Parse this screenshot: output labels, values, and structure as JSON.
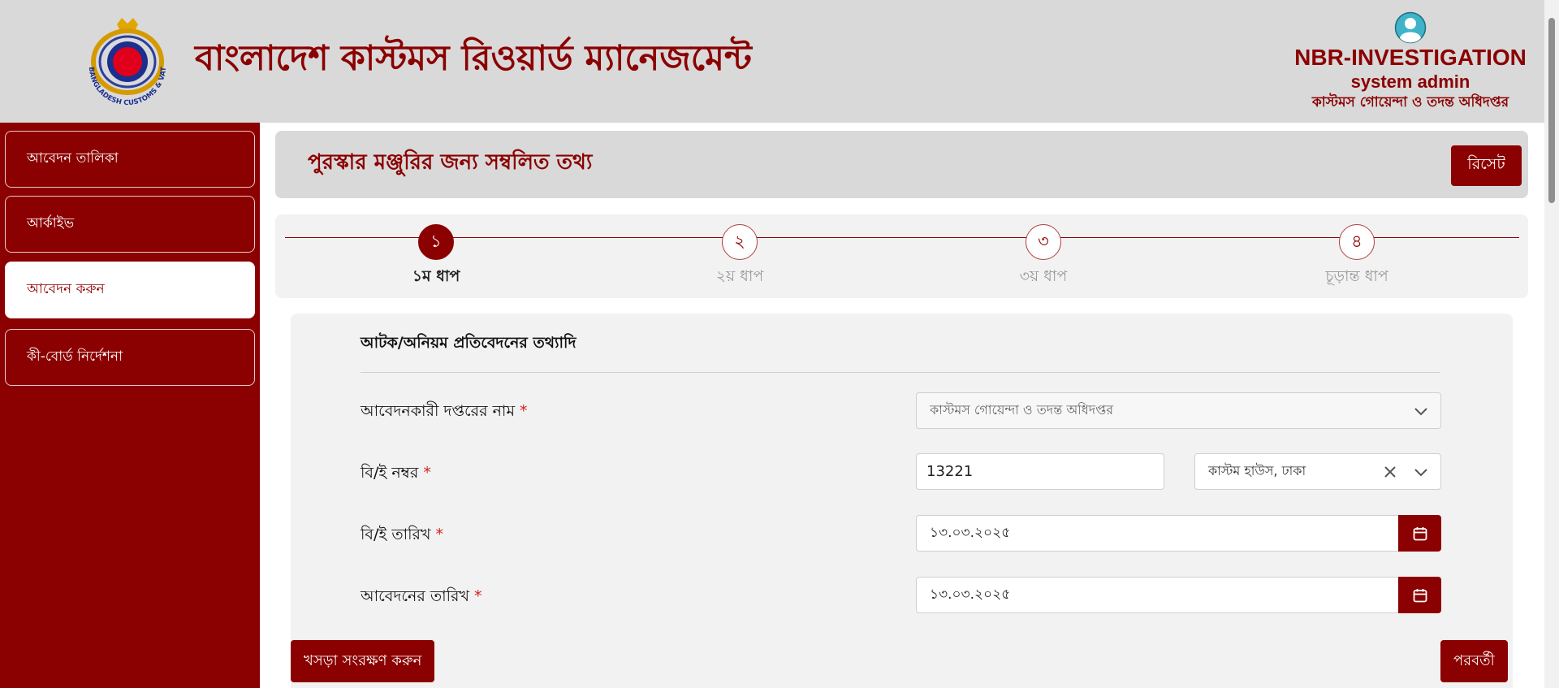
{
  "header": {
    "logo_text": "BANGLADESH CUSTOMS & VAT",
    "app_title": "বাংলাদেশ কাস্টমস রিওয়ার্ড ম্যানেজমেন্ট",
    "user": {
      "org": "NBR-INVESTIGATION",
      "name": "system admin",
      "office": "কাস্টমস গোয়েন্দা ও তদন্ত অধিদপ্তর"
    }
  },
  "sidebar": {
    "items": [
      {
        "label": "আবেদন তালিকা",
        "active": false
      },
      {
        "label": "আর্কাইভ",
        "active": false
      },
      {
        "label": "আবেদন করুন",
        "active": true
      },
      {
        "label": "কী-বোর্ড নির্দেশনা",
        "active": false
      }
    ]
  },
  "page": {
    "title": "পুরস্কার মঞ্জুরির জন্য সম্বলিত তথ্য",
    "reset_label": "রিসেট"
  },
  "stepper": {
    "steps": [
      {
        "number": "১",
        "label": "১ম ধাপ",
        "active": true
      },
      {
        "number": "২",
        "label": "২য় ধাপ",
        "active": false
      },
      {
        "number": "৩",
        "label": "৩য় ধাপ",
        "active": false
      },
      {
        "number": "৪",
        "label": "চূড়ান্ত ধাপ",
        "active": false
      }
    ]
  },
  "form": {
    "section_title": "আটক/অনিয়ম প্রতিবেদনের তথ্যাদি",
    "required_mark": "*",
    "fields": {
      "office_name": {
        "label": "আবেদনকারী দপ্তরের নাম",
        "value": "কাস্টমস গোয়েন্দা ও তদন্ত অধিদপ্তর"
      },
      "be_number": {
        "label": "বি/ই নম্বর",
        "value": "13221",
        "custom_house": "কাস্টম হাউস, ঢাকা"
      },
      "be_date": {
        "label": "বি/ই তারিখ",
        "value": "১৩.০৩.২০২৫"
      },
      "application_date": {
        "label": "আবেদনের তারিখ",
        "value": "১৩.০৩.২০২৫"
      }
    }
  },
  "footer": {
    "save_draft_label": "খসড়া সংরক্ষণ করুন",
    "next_label": "পরবর্তী"
  },
  "colors": {
    "primary": "#8b0000",
    "header_bg": "#d9d9d9",
    "card_bg": "#f2f2f2",
    "required": "#d42020"
  }
}
